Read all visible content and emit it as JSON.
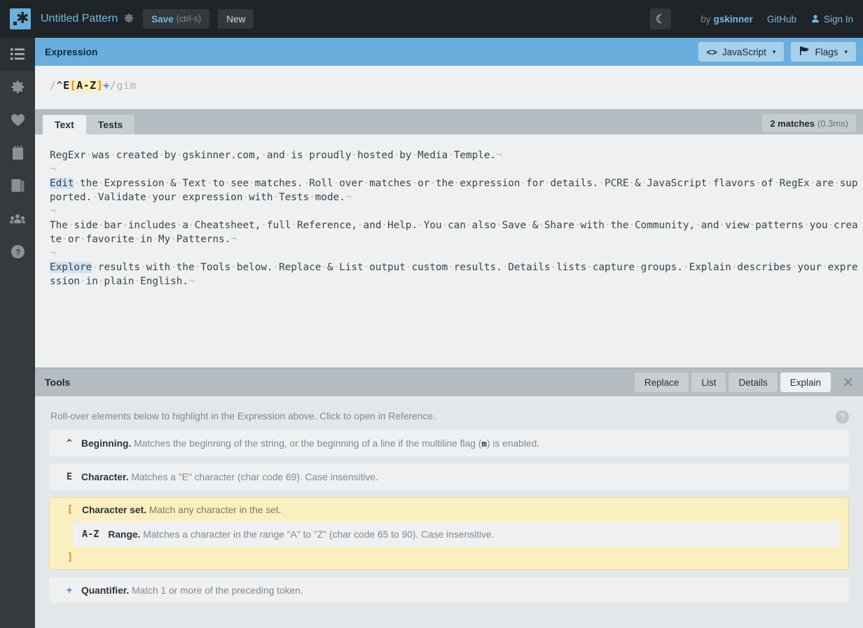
{
  "topbar": {
    "pattern_title": "Untitled Pattern",
    "gear_icon": "gear-icon",
    "save_label": "Save",
    "save_shortcut": "(ctrl-s)",
    "new_label": "New",
    "theme_toggle_icon": "moon-icon",
    "by_prefix": "by",
    "author": "gskinner",
    "github_label": "GitHub",
    "signin_label": "Sign In"
  },
  "rail": {
    "items": [
      {
        "name": "my-patterns",
        "icon": "list-icon"
      },
      {
        "name": "settings",
        "icon": "gear-icon"
      },
      {
        "name": "favorites",
        "icon": "heart-icon"
      },
      {
        "name": "cheatsheet",
        "icon": "cheatsheet-icon"
      },
      {
        "name": "reference",
        "icon": "book-icon"
      },
      {
        "name": "community",
        "icon": "community-icon"
      },
      {
        "name": "help",
        "icon": "question-icon"
      }
    ]
  },
  "expression": {
    "header_title": "Expression",
    "flavor_label": "JavaScript",
    "flavor_icon": "code-icon",
    "flags_label": "Flags",
    "flags_icon": "flag-icon",
    "caret": "▾",
    "open_slash": "/",
    "anchor": "^",
    "literal": "E",
    "bracket_open": "[",
    "range": "A-Z",
    "bracket_close": "]",
    "quantifier": "+",
    "close_slash": "/",
    "flags": "gim",
    "full": "/^E[A-Z]+/gim"
  },
  "text_panel": {
    "tabs": [
      {
        "label": "Text",
        "active": true
      },
      {
        "label": "Tests",
        "active": false
      }
    ],
    "match_count": "2 matches",
    "match_time": "(0.3ms)",
    "lines": [
      {
        "segments": [
          {
            "t": "RegExr was created by gskinner.com, and is proudly hosted by Media Temple.",
            "m": false
          }
        ],
        "eol": true
      },
      {
        "segments": [],
        "eol": true
      },
      {
        "segments": [
          {
            "t": "Edit",
            "m": true
          },
          {
            "t": " the Expression & Text to see matches. Roll over matches or the expression for details. PCRE & JavaScript flavors of RegEx are supported. Validate your expression with Tests mode.",
            "m": false
          }
        ],
        "eol": true
      },
      {
        "segments": [],
        "eol": true
      },
      {
        "segments": [
          {
            "t": "The side bar includes a Cheatsheet, full Reference, and Help. You can also Save & Share with the Community, and view patterns you create or favorite in My Patterns.",
            "m": false
          }
        ],
        "eol": true
      },
      {
        "segments": [],
        "eol": true
      },
      {
        "segments": [
          {
            "t": "Explore",
            "m": true
          },
          {
            "t": " results with the Tools below. Replace & List output custom results. Details lists capture groups. Explain describes your expression in plain English.",
            "m": false
          }
        ],
        "eol": true
      }
    ]
  },
  "tools": {
    "header_title": "Tools",
    "tabs": [
      {
        "label": "Replace",
        "active": false
      },
      {
        "label": "List",
        "active": false
      },
      {
        "label": "Details",
        "active": false
      },
      {
        "label": "Explain",
        "active": true
      }
    ],
    "close_icon": "close-icon",
    "hint": "Roll-over elements below to highlight in the Expression above. Click to open in Reference.",
    "help_icon": "question-icon",
    "explain_rows": [
      {
        "token": "^",
        "token_color": "default",
        "title": "Beginning.",
        "desc_before": " Matches the beginning of the string, or the beginning of a line if the multiline flag (",
        "desc_mono": "m",
        "desc_after": ") is enabled."
      },
      {
        "token": "E",
        "token_color": "default",
        "title": "Character.",
        "desc_before": " Matches a \"E\" character (char code 69). Case insensitive.",
        "desc_mono": "",
        "desc_after": ""
      }
    ],
    "explain_group": {
      "highlighted": true,
      "token_open": "[",
      "title": "Character set.",
      "desc": " Match any character in the set.",
      "child": {
        "token": "A-Z",
        "title": "Range.",
        "desc": " Matches a character in the range \"A\" to \"Z\" (char code 65 to 90). Case insensitive."
      },
      "token_close": "]"
    },
    "explain_last": {
      "token": "+",
      "token_color": "blue",
      "title": "Quantifier.",
      "desc": " Match 1 or more of the preceding token."
    }
  },
  "colors": {
    "accent_blue": "#6aaede",
    "dark_chrome": "#1f2428",
    "rail": "#343a3e",
    "match_highlight": "#cfe2f2",
    "set_highlight": "#faefc0",
    "bracket_orange": "#e08a23",
    "quantifier_blue": "#4f7fd4"
  }
}
